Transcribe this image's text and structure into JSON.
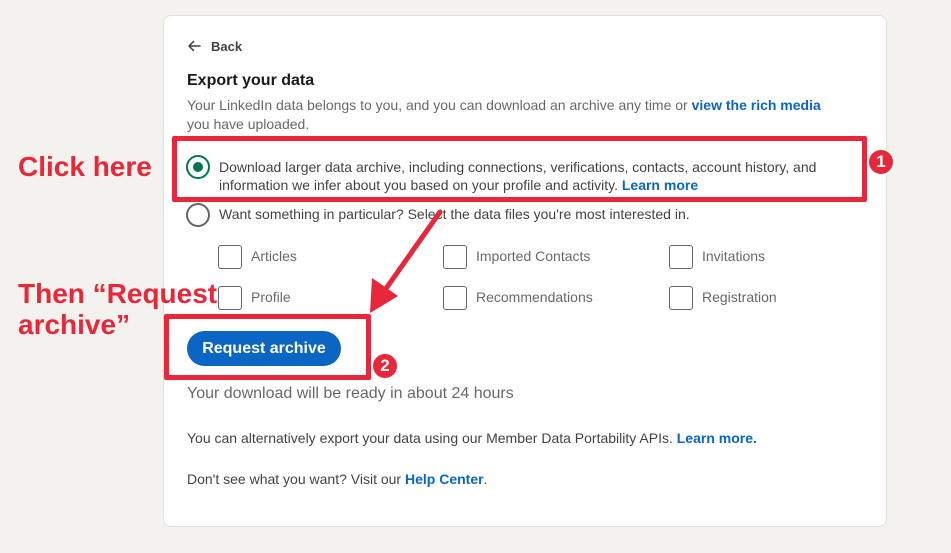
{
  "back": {
    "label": "Back"
  },
  "title": "Export your data",
  "intro": {
    "text_before": "Your LinkedIn data belongs to you, and you can download an archive any time or ",
    "link": "view the rich media",
    "text_after": " you have uploaded."
  },
  "options": [
    {
      "text": "Download larger data archive, including connections, verifications, contacts, account history, and information we infer about you based on your profile and activity. ",
      "link": "Learn more",
      "checked": true
    },
    {
      "text": "Want something in particular? Select the data files you're most interested in.",
      "checked": false
    }
  ],
  "checkboxes": [
    {
      "label": "Articles"
    },
    {
      "label": "Imported Contacts"
    },
    {
      "label": "Invitations"
    },
    {
      "label": "Profile"
    },
    {
      "label": "Recommendations"
    },
    {
      "label": "Registration"
    }
  ],
  "request_button": {
    "label": "Request archive"
  },
  "ready_text": "Your download will be ready in about 24 hours",
  "alt_export": {
    "text": "You can alternatively export your data using our Member Data Portability APIs. ",
    "link": "Learn more."
  },
  "help": {
    "text_before": "Don't see what you want? Visit our ",
    "link": "Help Center",
    "text_after": "."
  },
  "annotations": {
    "click_here": "Click here",
    "then_request_line1": "Then “Request",
    "then_request_line2": "archive”",
    "badge1": "1",
    "badge2": "2",
    "color": "#e8283a"
  }
}
